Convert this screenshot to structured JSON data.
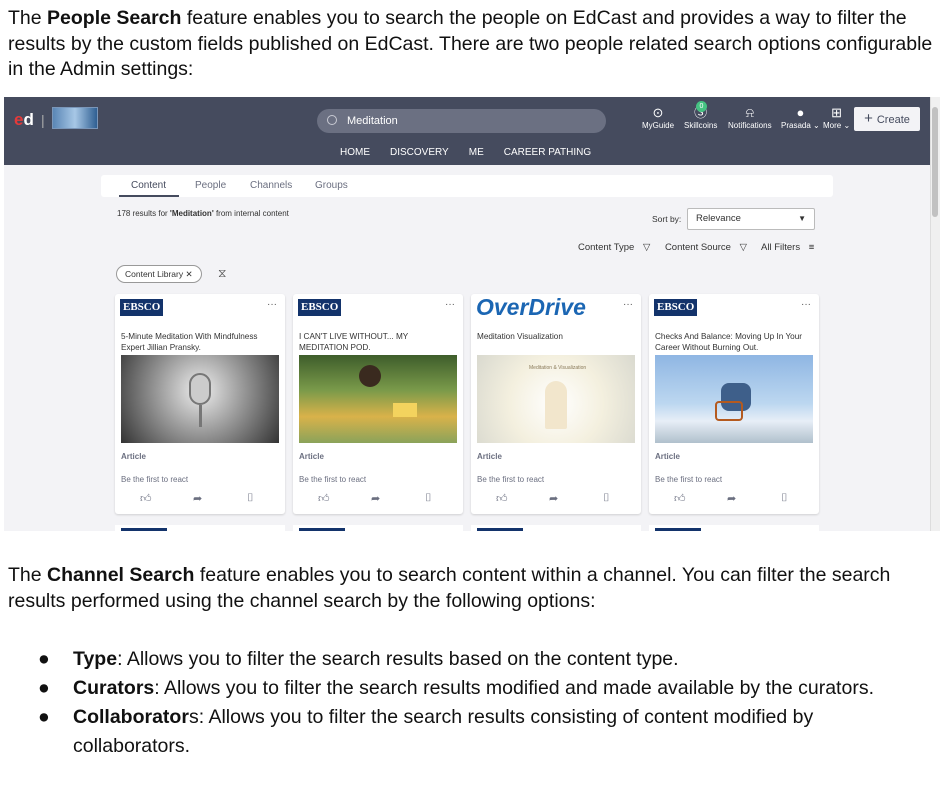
{
  "intro": {
    "prefix": "The ",
    "bold": "People Search",
    "suffix": " feature enables you to search the people on EdCast and provides a way to filter the results by the custom fields published on EdCast. There are two people related search options configurable in the Admin settings:"
  },
  "screenshot": {
    "logo_text_e": "e",
    "logo_text_d": "d",
    "search_query": "Meditation",
    "nav": [
      "HOME",
      "DISCOVERY",
      "ME",
      "CAREER PATHING"
    ],
    "top_icons": [
      {
        "label": "MyGuide",
        "icon": "location-pin-icon"
      },
      {
        "label": "Skillcoins",
        "icon": "skillcoins-icon",
        "badge": "0"
      },
      {
        "label": "Notifications",
        "icon": "bell-icon"
      },
      {
        "label": "Prasada",
        "icon": "avatar-icon"
      },
      {
        "label": "More",
        "icon": "grid-icon"
      }
    ],
    "create_label": "Create",
    "tabs": [
      "Content",
      "People",
      "Channels",
      "Groups"
    ],
    "results_prefix": "178 results for ",
    "results_query": "'Meditation'",
    "results_suffix": " from internal content",
    "sort_label": "Sort by:",
    "sort_value": "Relevance",
    "filters": [
      "Content Type",
      "Content Source",
      "All Filters"
    ],
    "chip_label": "Content Library",
    "cards": [
      {
        "brand": "EBSCO",
        "title": "5-Minute Meditation With Mindfulness Expert Jillian Pransky.",
        "type": "Article",
        "react": "Be the first to react"
      },
      {
        "brand": "EBSCO",
        "title": "I CAN'T LIVE WITHOUT... MY MEDITATION POD.",
        "type": "Article",
        "react": "Be the first to react"
      },
      {
        "brand": "OverDrive",
        "title": "Meditation Visualization",
        "type": "Article",
        "react": "Be the first to react",
        "thumb_text": "Meditation & Visualization"
      },
      {
        "brand": "EBSCO",
        "title": "Checks And Balance: Moving Up In Your Career Without Burning Out.",
        "type": "Article",
        "react": "Be the first to react"
      }
    ],
    "colors": {
      "topbar": "#454b5e",
      "ebsco": "#13336b",
      "overdrive": "#1b66b3"
    }
  },
  "channel": {
    "prefix": "The ",
    "bold": "Channel Search",
    "suffix": " feature enables you to search content within a channel. You can filter the search results performed using the channel search by the following options:"
  },
  "bullets": [
    {
      "bold": "Type",
      "text": ": Allows you to filter the search results based on the content type."
    },
    {
      "bold": "Curators",
      "text": ": Allows you to filter the search results modified and made available by the curators."
    },
    {
      "bold": "Collaborator",
      "text": "s: Allows you to filter the search results consisting of content modified by collaborators."
    }
  ]
}
